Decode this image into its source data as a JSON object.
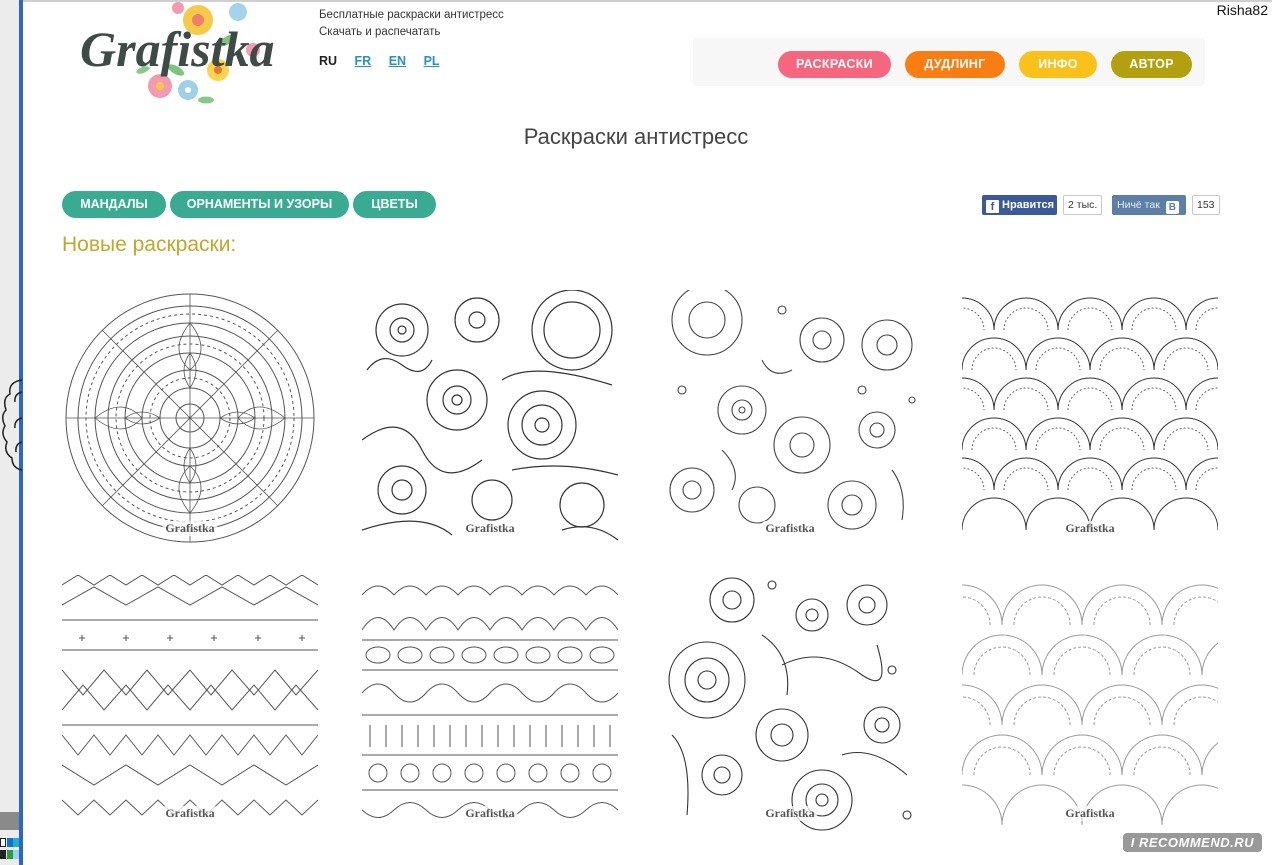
{
  "user": {
    "name": "Risha82"
  },
  "site": {
    "logo_text": "Grafistka",
    "tagline_1": "Бесплатные раскраски антистресс",
    "tagline_2": "Скачать и распечатать"
  },
  "languages": [
    {
      "code": "RU",
      "active": true
    },
    {
      "code": "FR",
      "active": false
    },
    {
      "code": "EN",
      "active": false
    },
    {
      "code": "PL",
      "active": false
    }
  ],
  "nav": [
    {
      "label": "РАСКРАСКИ",
      "color": "#f7667f"
    },
    {
      "label": "ДУДЛИНГ",
      "color": "#fa7d12"
    },
    {
      "label": "ИНФО",
      "color": "#f9c11a"
    },
    {
      "label": "АВТОР",
      "color": "#b3a00f"
    }
  ],
  "page_title": "Раскраски антистресс",
  "categories": [
    {
      "label": "МАНДАЛЫ"
    },
    {
      "label": "ОРНАМЕНТЫ И УЗОРЫ"
    },
    {
      "label": "ЦВЕТЫ"
    }
  ],
  "social": {
    "fb_like_label": "Нравится",
    "fb_count": "2 тыс.",
    "vk_label": "Ничё так",
    "vk_count": "153"
  },
  "section_title": "Новые раскраски:",
  "thumbnails": [
    {
      "pattern": "mandala",
      "watermark": "Grafistka"
    },
    {
      "pattern": "flowers-doodle",
      "watermark": "Grafistka"
    },
    {
      "pattern": "flowers-garden",
      "watermark": "Grafistka"
    },
    {
      "pattern": "scales",
      "watermark": "Grafistka"
    },
    {
      "pattern": "zigzag-ornament",
      "watermark": "Grafistka"
    },
    {
      "pattern": "border-ornament",
      "watermark": "Grafistka"
    },
    {
      "pattern": "floral-bouquet",
      "watermark": "Grafistka"
    },
    {
      "pattern": "scales-light",
      "watermark": "Grafistka"
    }
  ],
  "overlay_watermark": "I RECOMMEND.RU",
  "colors": {
    "category_green": "#3aab93",
    "section_gold": "#c4a62a",
    "frame_blue": "#2b66c9"
  }
}
